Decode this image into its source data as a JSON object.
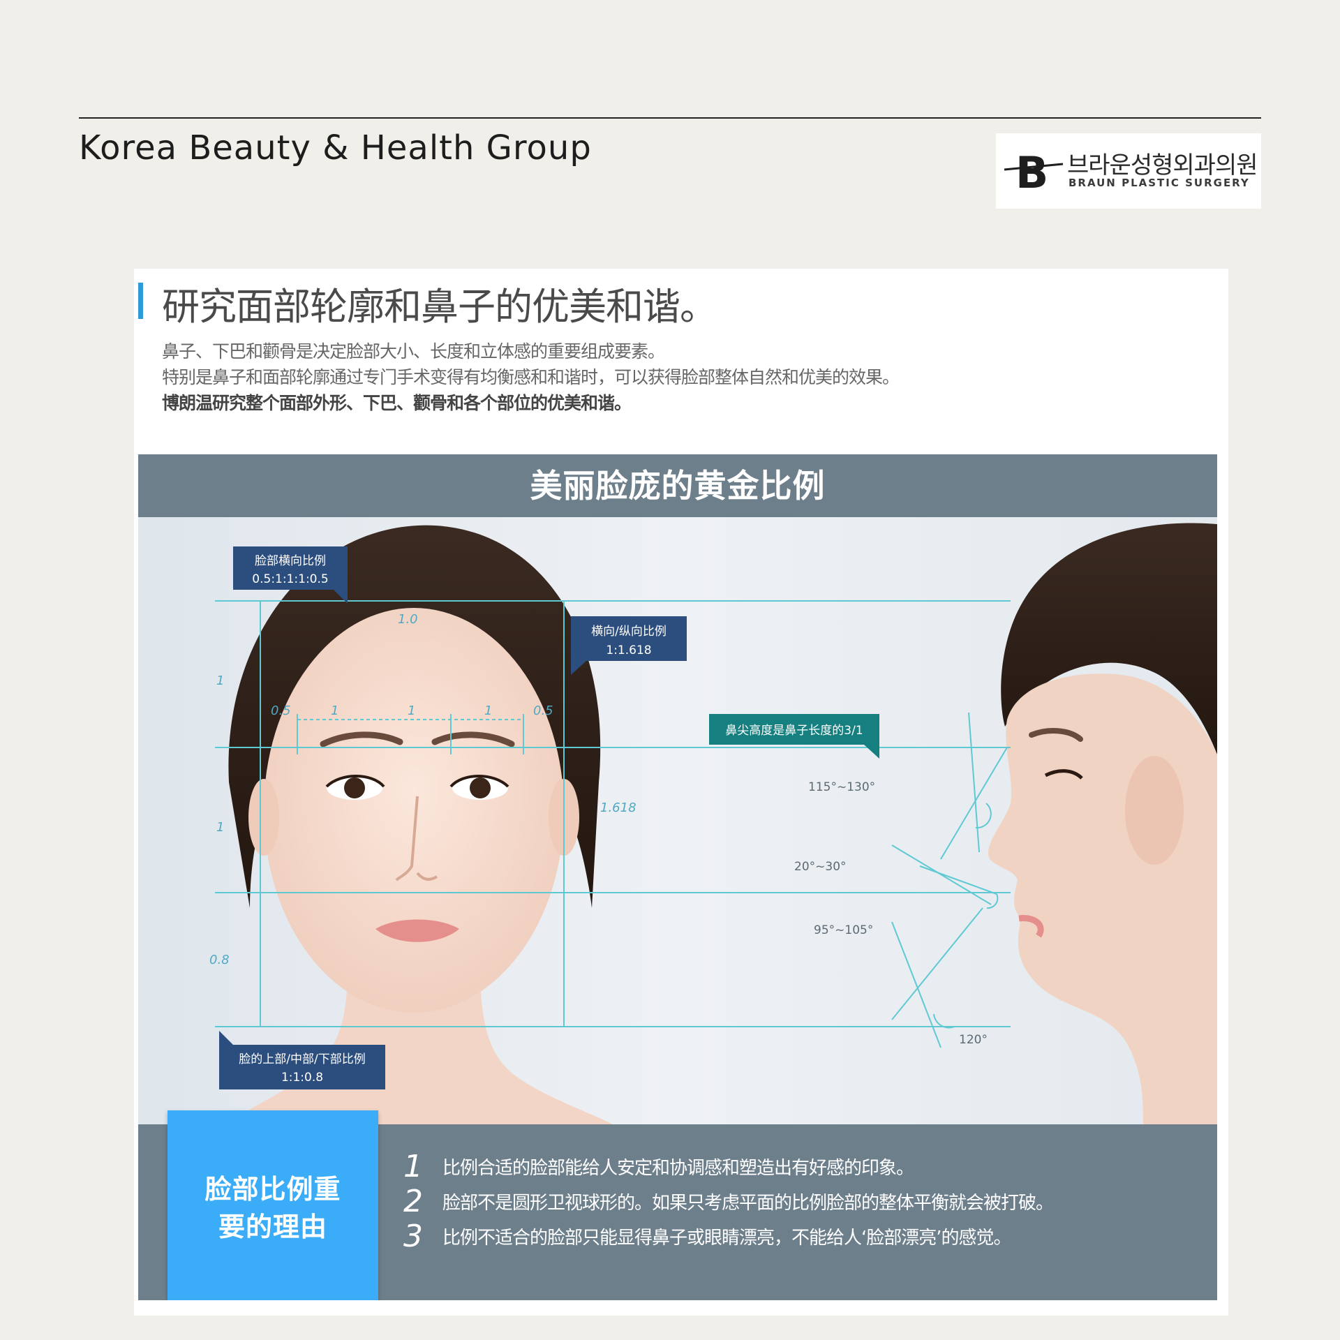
{
  "header": {
    "brand_title": "Korea Beauty & Health Group",
    "logo_letter": "B",
    "logo_korean": "브라운성형외과의원",
    "logo_english": "BRAUN PLASTIC SURGERY"
  },
  "card": {
    "heading": "研究面部轮廓和鼻子的优美和谐。",
    "intro_lines": [
      "鼻子、下巴和颧骨是决定脸部大小、长度和立体感的重要组成要素。",
      "特别是鼻子和面部轮廓通过专门手术变得有均衡感和和谐时，可以获得脸部整体自然和优美的效果。",
      "博朗温研究整个面部外形、下巴、颧骨和各个部位的优美和谐。"
    ]
  },
  "figure": {
    "band_title": "美丽脸庞的黄金比例",
    "callouts": {
      "horizontal_title": "脸部横向比例",
      "horizontal_value": "0.5:1:1:1:0.5",
      "ratio_title": "横向/纵向比例",
      "ratio_value": "1:1.618",
      "nose_tip": "鼻尖高度是鼻子长度的3/1",
      "vertical_title": "脸的上部/中部/下部比例",
      "vertical_value": "1:1:0.8"
    },
    "measurements": {
      "top_width": "1.0",
      "upper": "1",
      "middle": "1",
      "lower": "0.8",
      "half_left": "0.5",
      "one_a": "1",
      "one_b": "1",
      "one_c": "1",
      "half_right": "0.5",
      "golden": "1.618"
    },
    "angles": {
      "a1": "115°~130°",
      "a2": "20°~30°",
      "a3": "95°~105°",
      "a4": "120°"
    },
    "reason_title_line1": "脸部比例重",
    "reason_title_line2": "要的理由",
    "reasons": [
      {
        "num": "1",
        "text": "比例合适的脸部能给人安定和协调感和塑造出有好感的印象。"
      },
      {
        "num": "2",
        "text": "脸部不是圆形卫视球形的。如果只考虑平面的比例脸部的整体平衡就会被打破。"
      },
      {
        "num": "3",
        "text": "比例不适合的脸部只能显得鼻子或眼睛漂亮，不能给人‘脸部漂亮’的感觉。"
      }
    ]
  },
  "colors": {
    "page_bg": "#f0efe9",
    "accent_blue": "#2f9ad9",
    "band_gray": "#6e7f8c",
    "reason_blue": "#3bacf7",
    "callout_navy": "#2c4e7e",
    "callout_teal": "#167f7f",
    "guide_cyan": "#5fc9d3"
  }
}
